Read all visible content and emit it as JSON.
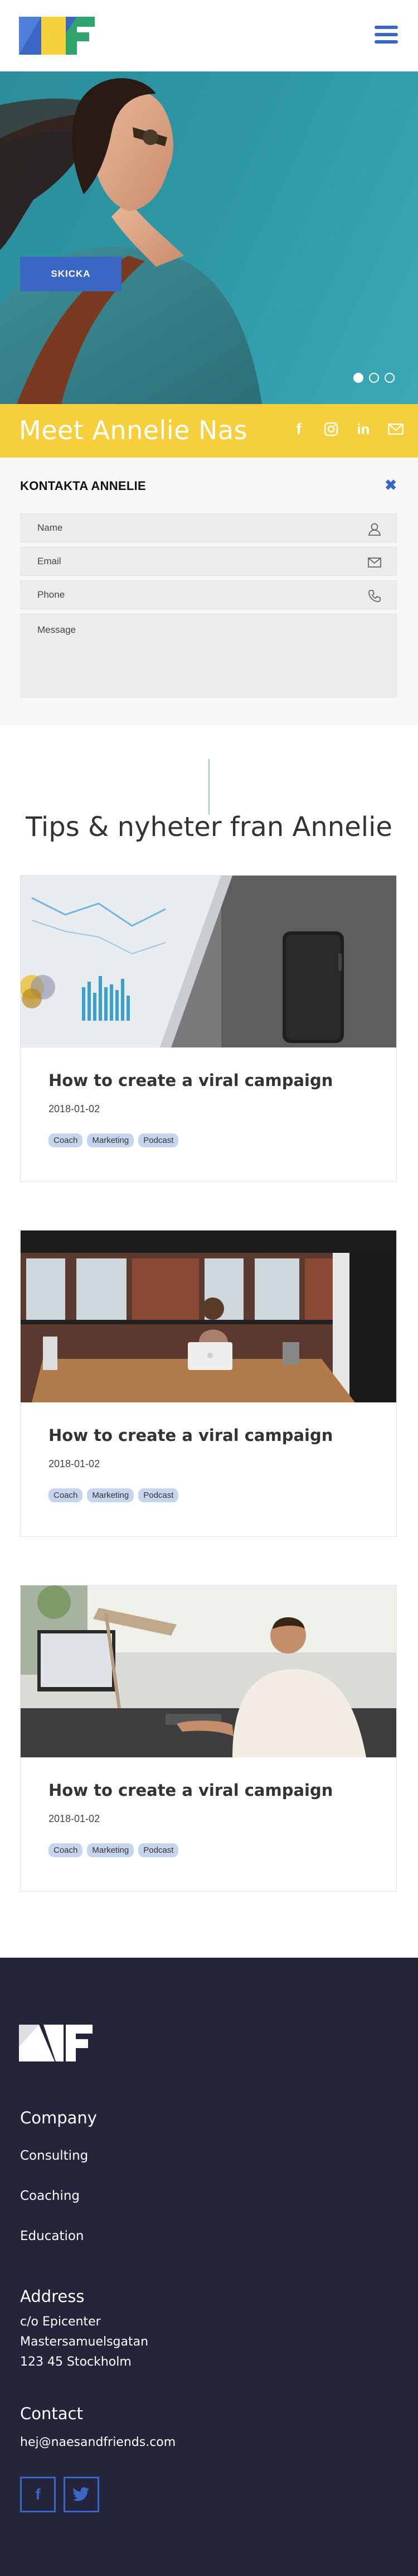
{
  "header": {
    "logo_icon": "naes-friends-logo",
    "menu_icon": "hamburger-menu-icon",
    "colors": {
      "blue": "#3a66c4",
      "yellow": "#f6cf3d",
      "green": "#2fa56d"
    }
  },
  "hero": {
    "slides": 3,
    "active_slide": 1,
    "background": "#2e96a4"
  },
  "band": {
    "title": "Meet Annelie Nas",
    "social_icons": [
      "facebook-icon",
      "instagram-icon",
      "linkedin-icon",
      "mail-icon"
    ],
    "linkedin_label": "in",
    "facebook_label": "f"
  },
  "contact": {
    "title": "KONTAKTA ANNELIE",
    "close_label": "✖",
    "fields": {
      "name": {
        "placeholder": "Name",
        "icon": "user-icon"
      },
      "email": {
        "placeholder": "Email",
        "icon": "envelope-icon"
      },
      "phone": {
        "placeholder": "Phone",
        "icon": "phone-icon"
      },
      "message": {
        "placeholder": "Message"
      }
    },
    "submit_label": "SKICKA"
  },
  "tips": {
    "title": "Tips & nyheter fran Annelie",
    "posts": [
      {
        "title": "How to create a viral campaign",
        "date": "2018-01-02",
        "tags": [
          "Coach",
          "Marketing",
          "Podcast"
        ]
      },
      {
        "title": "How to create a viral campaign",
        "date": "2018-01-02",
        "tags": [
          "Coach",
          "Marketing",
          "Podcast"
        ]
      },
      {
        "title": "How to create a viral campaign",
        "date": "2018-01-02",
        "tags": [
          "Coach",
          "Marketing",
          "Podcast"
        ]
      }
    ]
  },
  "footer": {
    "background": "#23263a",
    "company": {
      "title": "Company",
      "links": [
        "Consulting",
        "Coaching",
        "Education"
      ]
    },
    "address": {
      "title": "Address",
      "lines": [
        "c/o Epicenter",
        "Mastersamuelsgatan",
        "123 45 Stockholm"
      ]
    },
    "contact": {
      "title": "Contact",
      "email": "hej@naesandfriends.com"
    },
    "social": {
      "facebook": "f",
      "twitter_icon": "twitter-icon"
    }
  }
}
